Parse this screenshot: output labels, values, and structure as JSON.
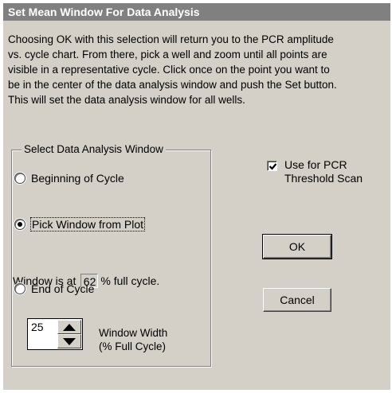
{
  "window": {
    "title": "Set Mean Window For Data Analysis"
  },
  "description": {
    "lines": [
      "Choosing OK with this selection will return you to the PCR amplitude",
      "vs. cycle chart.  From there, pick a well and zoom until all points are",
      "visible in a representative cycle.  Click once on the point you want to",
      "be in the center of the data analysis window and push the Set button.",
      "This will set the data analysis window for all wells."
    ]
  },
  "group": {
    "legend": "Select Data Analysis Window",
    "options": [
      {
        "label": "Beginning of Cycle",
        "selected": false
      },
      {
        "label": "Pick Window from Plot",
        "selected": true
      },
      {
        "label": "End of Cycle",
        "selected": false
      }
    ],
    "window_prefix": "Window is at",
    "window_value": "62",
    "window_suffix": "%  full cycle.",
    "spin_value": "25",
    "width_label_line1": "Window Width",
    "width_label_line2": "(% Full Cycle)"
  },
  "threshold": {
    "label_line1": "Use for PCR",
    "label_line2": "Threshold Scan",
    "checked": true
  },
  "buttons": {
    "ok": "OK",
    "cancel": "Cancel"
  },
  "icons": {
    "spin_up": "triangle-up-icon",
    "spin_down": "triangle-down-icon",
    "check": "checkmark-icon"
  }
}
